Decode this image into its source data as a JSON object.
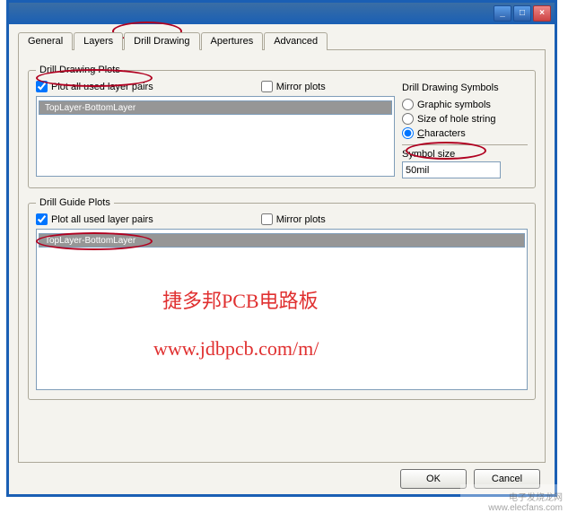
{
  "tabs": {
    "general": "General",
    "layers": "Layers",
    "drill_drawing": "Drill Drawing",
    "apertures": "Apertures",
    "advanced": "Advanced"
  },
  "drill_drawing": {
    "legend": "Drill Drawing Plots",
    "plot_all_used": "Plot all used layer pairs",
    "mirror_plots": "Mirror plots",
    "list_item": "TopLayer-BottomLayer",
    "symbols_title": "Drill Drawing Symbols",
    "opt_graphic": "Graphic symbols",
    "opt_size": "Size of hole string",
    "opt_chars_pre": "C",
    "opt_chars_rest": "haracters",
    "symbol_size_label": "Symbol size",
    "symbol_size_value": "50mil"
  },
  "drill_guide": {
    "legend": "Drill Guide Plots",
    "plot_all_used": "Plot all used layer pairs",
    "mirror_plots": "Mirror plots",
    "list_item": "TopLayer-BottomLayer"
  },
  "buttons": {
    "ok": "OK",
    "cancel": "Cancel"
  },
  "watermarks": {
    "wm1": "捷多邦PCB电路板",
    "wm2": "www.jdbpcb.com/m/",
    "corner": "电子发烧龙网 www.elecfans.com"
  }
}
